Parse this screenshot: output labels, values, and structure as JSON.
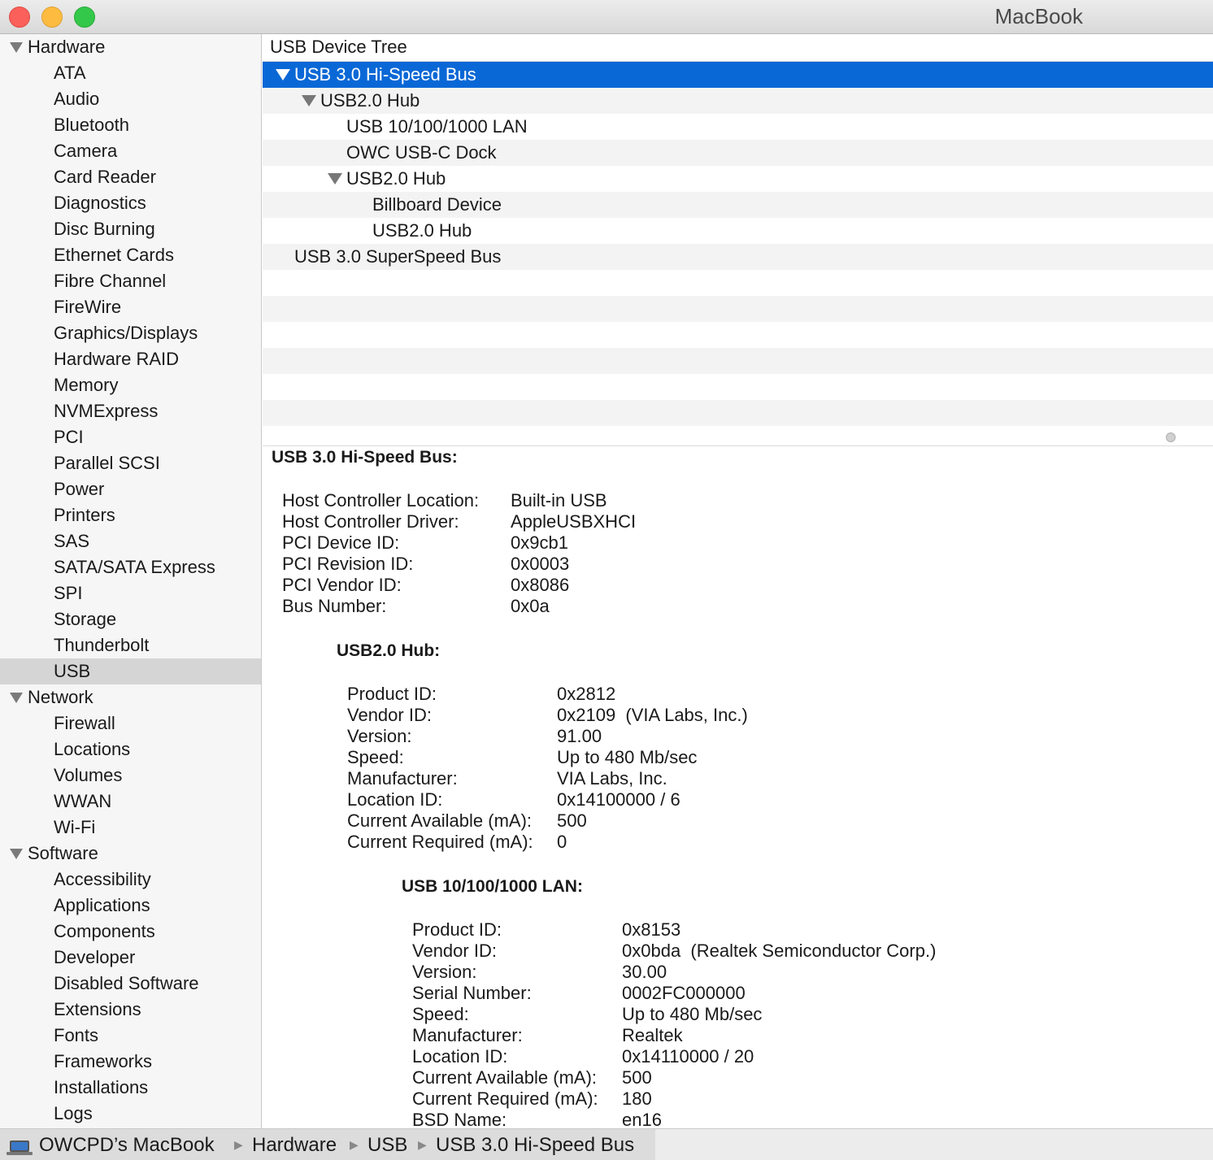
{
  "window": {
    "title": "MacBook"
  },
  "sidebar": {
    "sections": [
      {
        "label": "Hardware",
        "items": [
          "ATA",
          "Audio",
          "Bluetooth",
          "Camera",
          "Card Reader",
          "Diagnostics",
          "Disc Burning",
          "Ethernet Cards",
          "Fibre Channel",
          "FireWire",
          "Graphics/Displays",
          "Hardware RAID",
          "Memory",
          "NVMExpress",
          "PCI",
          "Parallel SCSI",
          "Power",
          "Printers",
          "SAS",
          "SATA/SATA Express",
          "SPI",
          "Storage",
          "Thunderbolt",
          "USB"
        ]
      },
      {
        "label": "Network",
        "items": [
          "Firewall",
          "Locations",
          "Volumes",
          "WWAN",
          "Wi-Fi"
        ]
      },
      {
        "label": "Software",
        "items": [
          "Accessibility",
          "Applications",
          "Components",
          "Developer",
          "Disabled Software",
          "Extensions",
          "Fonts",
          "Frameworks",
          "Installations",
          "Logs"
        ]
      }
    ],
    "selected": "USB"
  },
  "tree": {
    "header": "USB Device Tree",
    "rows": [
      {
        "label": "USB 3.0 Hi-Speed Bus",
        "expanded": true,
        "selected": true
      },
      {
        "label": "USB2.0 Hub",
        "expanded": true
      },
      {
        "label": "USB 10/100/1000 LAN"
      },
      {
        "label": "OWC USB-C Dock"
      },
      {
        "label": "USB2.0 Hub",
        "expanded": true
      },
      {
        "label": "Billboard Device"
      },
      {
        "label": "USB2.0 Hub"
      },
      {
        "label": "USB 3.0 SuperSpeed Bus"
      }
    ]
  },
  "detail": {
    "bus": {
      "title": "USB 3.0 Hi-Speed Bus:",
      "fields": [
        {
          "k": "Host Controller Location:",
          "v": "Built-in USB"
        },
        {
          "k": "Host Controller Driver:",
          "v": "AppleUSBXHCI"
        },
        {
          "k": "PCI Device ID:",
          "v": "0x9cb1"
        },
        {
          "k": "PCI Revision ID:",
          "v": "0x0003"
        },
        {
          "k": "PCI Vendor ID:",
          "v": "0x8086"
        },
        {
          "k": "Bus Number:",
          "v": "0x0a"
        }
      ]
    },
    "hub": {
      "title": "USB2.0 Hub:",
      "fields": [
        {
          "k": "Product ID:",
          "v": "0x2812"
        },
        {
          "k": "Vendor ID:",
          "v": "0x2109  (VIA Labs, Inc.)"
        },
        {
          "k": "Version:",
          "v": "91.00"
        },
        {
          "k": "Speed:",
          "v": "Up to 480 Mb/sec"
        },
        {
          "k": "Manufacturer:",
          "v": "VIA Labs, Inc."
        },
        {
          "k": "Location ID:",
          "v": "0x14100000 / 6"
        },
        {
          "k": "Current Available (mA):",
          "v": "500"
        },
        {
          "k": "Current Required (mA):",
          "v": "0"
        }
      ]
    },
    "lan": {
      "title": "USB 10/100/1000 LAN:",
      "fields": [
        {
          "k": "Product ID:",
          "v": "0x8153"
        },
        {
          "k": "Vendor ID:",
          "v": "0x0bda  (Realtek Semiconductor Corp.)"
        },
        {
          "k": "Version:",
          "v": "30.00"
        },
        {
          "k": "Serial Number:",
          "v": "0002FC000000"
        },
        {
          "k": "Speed:",
          "v": "Up to 480 Mb/sec"
        },
        {
          "k": "Manufacturer:",
          "v": "Realtek"
        },
        {
          "k": "Location ID:",
          "v": "0x14110000 / 20"
        },
        {
          "k": "Current Available (mA):",
          "v": "500"
        },
        {
          "k": "Current Required (mA):",
          "v": "180"
        },
        {
          "k": "BSD Name:",
          "v": "en16"
        }
      ]
    }
  },
  "pathbar": {
    "items": [
      "OWCPD’s MacBook",
      "Hardware",
      "USB",
      "USB 3.0 Hi-Speed Bus"
    ]
  }
}
